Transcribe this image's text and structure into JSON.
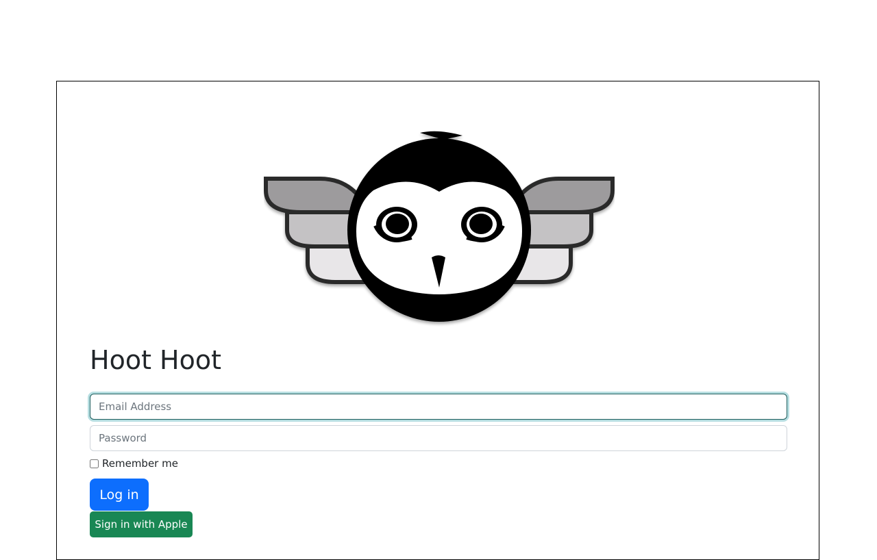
{
  "app": {
    "title": "Hoot Hoot",
    "logo_icon": "owl-logo"
  },
  "login_form": {
    "email_placeholder": "Email Address",
    "email_value": "",
    "password_placeholder": "Password",
    "password_value": "",
    "remember_label": "Remember me",
    "remember_checked": false,
    "login_label": "Log in",
    "apple_label": "Sign in with Apple"
  },
  "colors": {
    "primary": "#0d6efd",
    "success": "#198754",
    "focus_ring": "#30a0aa"
  }
}
